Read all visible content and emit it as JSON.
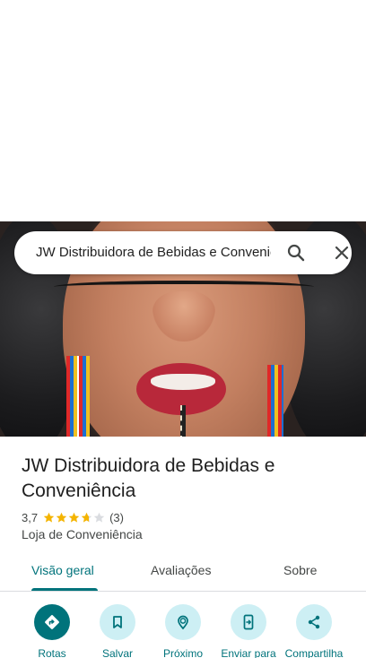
{
  "search": {
    "query": "JW Distribuidora de Bebidas e Conveniência",
    "search_icon": "search-icon",
    "close_icon": "close-icon"
  },
  "place": {
    "name": "JW Distribuidora de Bebidas e Conveniência",
    "rating": "3,7",
    "rating_value": 3.7,
    "review_count": "(3)",
    "category": "Loja de Conveniência"
  },
  "tabs": [
    {
      "label": "Visão geral",
      "active": true
    },
    {
      "label": "Avaliações",
      "active": false
    },
    {
      "label": "Sobre",
      "active": false
    }
  ],
  "actions": [
    {
      "label": "Rotas",
      "icon": "directions-icon"
    },
    {
      "label": "Salvar",
      "icon": "bookmark-icon"
    },
    {
      "label": "Próximo",
      "icon": "nearby-icon"
    },
    {
      "label": "Enviar para",
      "icon": "send-to-phone-icon"
    },
    {
      "label": "Compartilha",
      "icon": "share-icon"
    }
  ],
  "colors": {
    "accent": "#00737b",
    "action_bg": "#cdeff4",
    "star": "#f4b400",
    "star_empty": "#dadce0"
  }
}
